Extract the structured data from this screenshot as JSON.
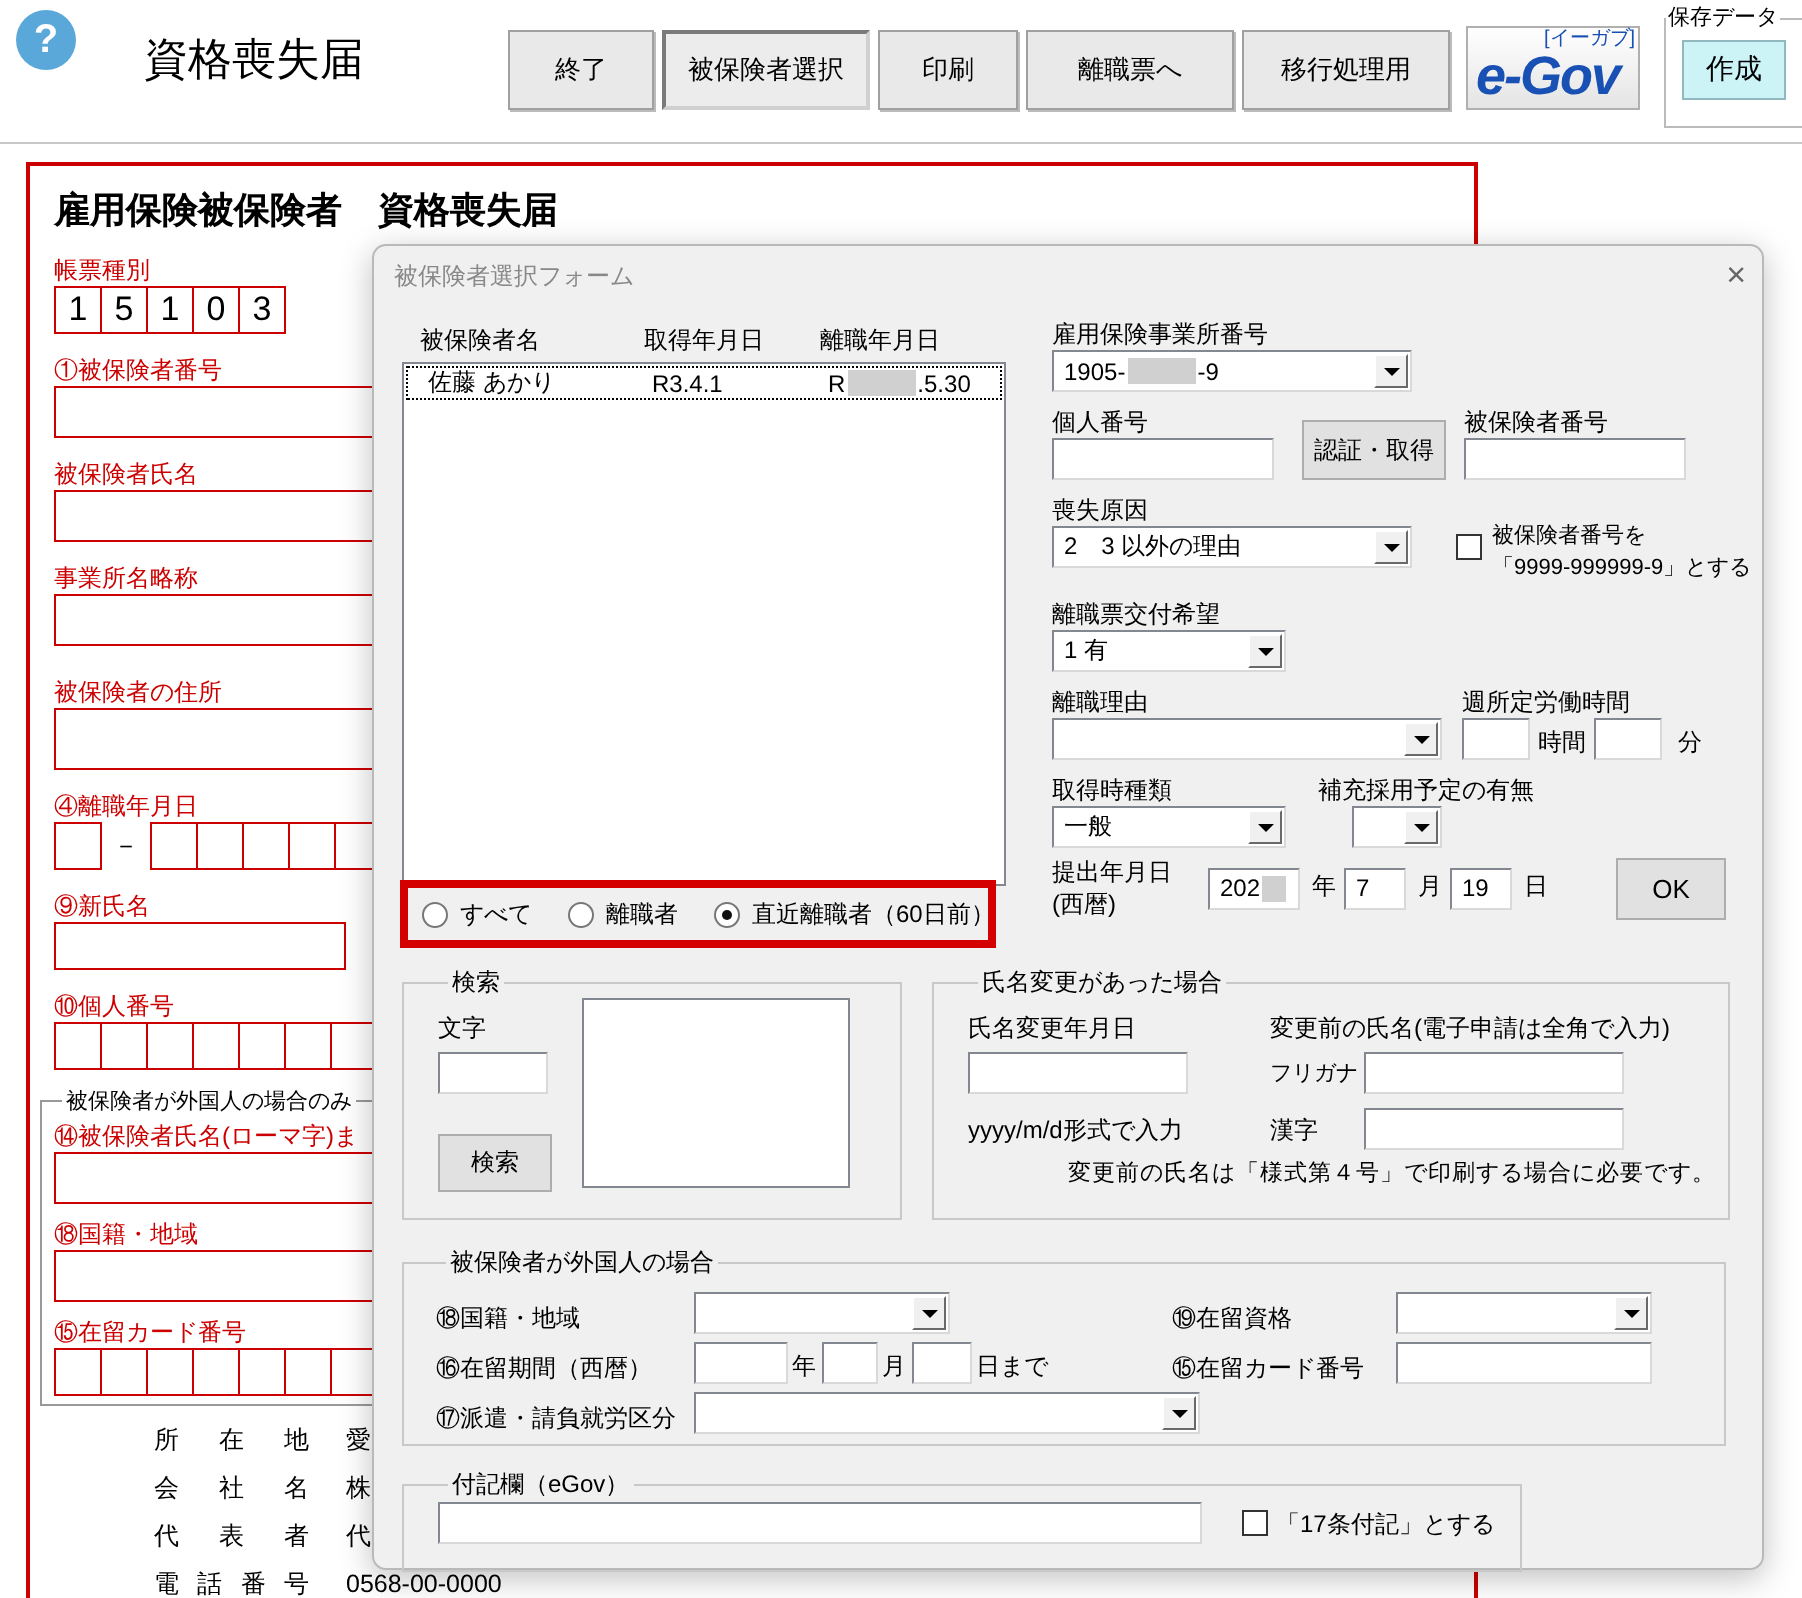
{
  "toolbar": {
    "help_icon": "?",
    "title": "資格喪失届",
    "buttons": [
      {
        "label": "終了",
        "pressed": false
      },
      {
        "label": "被保険者選択",
        "pressed": true
      },
      {
        "label": "印刷",
        "pressed": false
      },
      {
        "label": "離職票へ",
        "pressed": false
      },
      {
        "label": "移行処理用",
        "pressed": false
      }
    ],
    "logo": {
      "text": "e-Gov",
      "ruby": "[イーガブ]"
    },
    "save_group": {
      "legend": "保存データ",
      "button": "作成"
    }
  },
  "form": {
    "heading": "雇用保険被保険者　資格喪失届",
    "fields": [
      {
        "kind": "boxes",
        "label": "帳票種別",
        "boxes": [
          "1",
          "5",
          "1",
          "0",
          "3"
        ]
      },
      {
        "kind": "line",
        "label": "①被保険者番号"
      },
      {
        "kind": "line",
        "label": "被保険者氏名"
      },
      {
        "kind": "line",
        "label": "事業所名略称"
      },
      {
        "kind": "tall",
        "label": "被保険者の住所"
      },
      {
        "kind": "date",
        "label": "④離職年月日",
        "separator": "－"
      },
      {
        "kind": "short",
        "label": "⑨新氏名"
      },
      {
        "kind": "empty_boxes",
        "label": "⑩個人番号"
      }
    ],
    "foreign_group": {
      "legend": "被保険者が外国人の場合のみ",
      "fields": [
        {
          "kind": "line",
          "label": "⑭被保険者氏名(ローマ字)ま"
        },
        {
          "kind": "line",
          "label": "⑱国籍・地域"
        },
        {
          "kind": "empty_boxes",
          "label": "⑮在留カード番号"
        }
      ]
    },
    "company": [
      {
        "label": "所在地",
        "value": "愛"
      },
      {
        "label": "会社名",
        "value": "株"
      },
      {
        "label": "代表者",
        "value": "代"
      },
      {
        "label": "電話番号",
        "value": "0568-00-0000"
      }
    ]
  },
  "dialog": {
    "title": "被保険者選択フォーム",
    "close": "×",
    "list": {
      "columns": [
        "被保険者名",
        "取得年月日",
        "離職年月日"
      ],
      "rows": [
        {
          "cells": [
            [
              "佐藤 あかり"
            ],
            [
              "R3.4.1"
            ],
            [
              "R",
              {
                "kind": "redaction"
              },
              ".5.30"
            ]
          ],
          "selected": true
        }
      ]
    },
    "filter": {
      "highlighted": true,
      "options": [
        {
          "label": "すべて",
          "selected": false
        },
        {
          "label": "離職者",
          "selected": false
        },
        {
          "label": "直近離職者（60日前）",
          "selected": true
        }
      ]
    },
    "office_number": {
      "label": "雇用保険事業所番号",
      "value": [
        "1905-",
        {
          "kind": "redaction"
        },
        "-9"
      ]
    },
    "personal_number": {
      "label": "個人番号",
      "button": "認証・取得"
    },
    "insured_number": {
      "label": "被保険者番号"
    },
    "loss_reason": {
      "label": "喪失原因",
      "value": [
        "2　3 以外の理由"
      ]
    },
    "dummy_number": {
      "label_lines": [
        "被保険者番号を",
        "「9999-999999-9」とする"
      ],
      "checked": false
    },
    "separation_slip": {
      "label": "離職票交付希望",
      "value": [
        "1 有"
      ]
    },
    "separation_reason": {
      "label": "離職理由"
    },
    "weekly_hours": {
      "label": "週所定労働時間",
      "hours_unit": "時間",
      "minutes_unit": "分"
    },
    "acquisition_type": {
      "label": "取得時種類",
      "value": [
        "一般"
      ]
    },
    "replacement": {
      "label": "補充採用予定の有無"
    },
    "submit_date": {
      "label": "提出年月日",
      "sublabel": "(西暦)",
      "year": [
        "202",
        {
          "kind": "redaction"
        }
      ],
      "year_unit": "年",
      "month": "7",
      "month_unit": "月",
      "day": "19",
      "day_unit": "日"
    },
    "ok_button": "OK",
    "search": {
      "legend": "検索",
      "text_label": "文字",
      "button": "検索"
    },
    "name_change": {
      "legend": "氏名変更があった場合",
      "date_label": "氏名変更年月日",
      "date_hint": "yyyy/m/d形式で入力",
      "former_label": "変更前の氏名(電子申請は全角で入力)",
      "kana_label": "フリガナ",
      "kanji_label": "漢字",
      "note": "変更前の氏名は「様式第４号」で印刷する場合に必要です。"
    },
    "foreign": {
      "legend": "被保険者が外国人の場合",
      "nationality": "⑱国籍・地域",
      "status": "⑲在留資格",
      "period": "⑯在留期間（西暦）",
      "period_units": [
        "年",
        "月",
        "日まで"
      ],
      "card": "⑮在留カード番号",
      "dispatch": "⑰派遣・請負就労区分"
    },
    "note_field": {
      "legend": "付記欄（eGov）",
      "checkbox_label": "「17条付記」とする",
      "checked": false
    }
  }
}
